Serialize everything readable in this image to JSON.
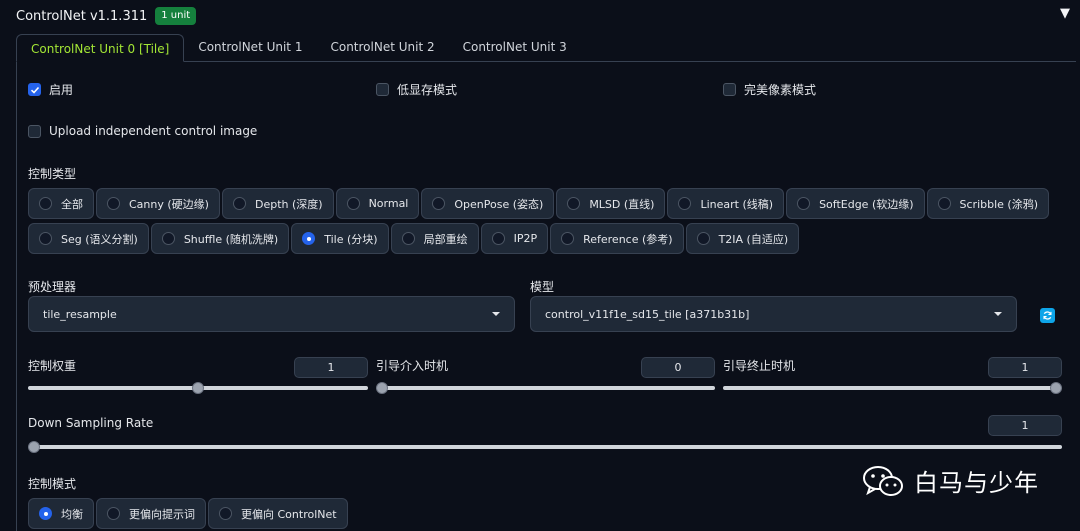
{
  "header": {
    "title": "ControlNet v1.1.311",
    "badge": "1 unit",
    "collapse_glyph": "▼"
  },
  "tabs": [
    {
      "label": "ControlNet Unit 0 [Tile]",
      "active": true
    },
    {
      "label": "ControlNet Unit 1",
      "active": false
    },
    {
      "label": "ControlNet Unit 2",
      "active": false
    },
    {
      "label": "ControlNet Unit 3",
      "active": false
    }
  ],
  "options": {
    "enable": {
      "label": "启用",
      "checked": true
    },
    "low_vram": {
      "label": "低显存模式",
      "checked": false
    },
    "pixel_perfect": {
      "label": "完美像素模式",
      "checked": false
    },
    "upload_independent": {
      "label": "Upload independent control image",
      "checked": false
    }
  },
  "control_type": {
    "label": "控制类型",
    "selected": "Tile (分块)",
    "row1": [
      "全部",
      "Canny (硬边缘)",
      "Depth (深度)",
      "Normal",
      "OpenPose (姿态)",
      "MLSD (直线)",
      "Lineart (线稿)",
      "SoftEdge (软边缘)",
      "Scribble (涂鸦)"
    ],
    "row2": [
      "Seg (语义分割)",
      "Shuffle (随机洗牌)",
      "Tile (分块)",
      "局部重绘",
      "IP2P",
      "Reference (参考)",
      "T2IA (自适应)"
    ]
  },
  "preprocessor": {
    "label": "预处理器",
    "value": "tile_resample"
  },
  "model": {
    "label": "模型",
    "value": "control_v11f1e_sd15_tile [a371b31b]"
  },
  "sliders": {
    "weight": {
      "label": "控制权重",
      "value": "1",
      "fraction": 0.5
    },
    "start": {
      "label": "引导介入时机",
      "value": "0",
      "fraction": 0.0
    },
    "end": {
      "label": "引导终止时机",
      "value": "1",
      "fraction": 1.0
    },
    "downsampling": {
      "label": "Down Sampling Rate",
      "value": "1",
      "fraction": 0.0
    }
  },
  "control_mode": {
    "label": "控制模式",
    "selected": "均衡",
    "options": [
      "均衡",
      "更偏向提示词",
      "更偏向 ControlNet"
    ]
  },
  "watermark": {
    "text": "白马与少年",
    "icon": "wechat-icon"
  },
  "colors": {
    "accent_blue": "#2563eb",
    "tab_active": "#a3e635",
    "badge_green": "#15803d",
    "refresh_blue": "#0ea5e9"
  }
}
